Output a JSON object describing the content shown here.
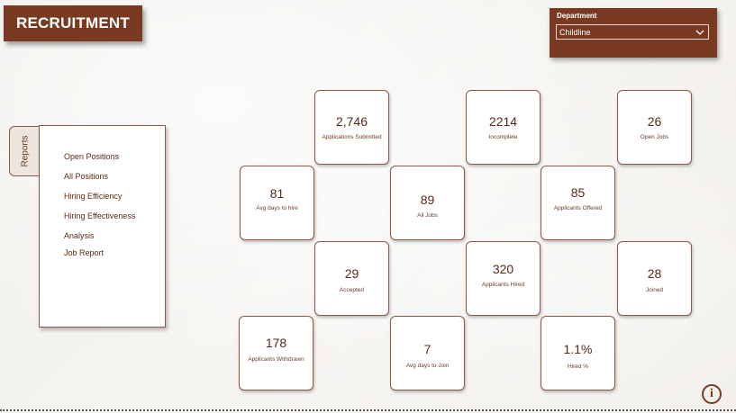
{
  "title": "RECRUITMENT",
  "department": {
    "label": "Department",
    "selected": "Childline"
  },
  "reports": {
    "tab_label": "Reports",
    "items": [
      {
        "label": "Open Positions"
      },
      {
        "label": "All Positions"
      },
      {
        "label": "Hiring Efficiency"
      },
      {
        "label": "Hiring Effectiveness"
      },
      {
        "label": "Analysis"
      },
      {
        "label": "Job Report"
      }
    ]
  },
  "cards": [
    {
      "value": "2,746",
      "label": "Applications Submitted"
    },
    {
      "value": "2214",
      "label": "Incomplete"
    },
    {
      "value": "26",
      "label": "Open Jobs"
    },
    {
      "value": "81",
      "label": "Avg days to hire"
    },
    {
      "value": "89",
      "label": "All Jobs"
    },
    {
      "value": "85",
      "label": "Applicants Offered"
    },
    {
      "value": "29",
      "label": "Accepted"
    },
    {
      "value": "320",
      "label": "Applicants Hired"
    },
    {
      "value": "28",
      "label": "Joined"
    },
    {
      "value": "178",
      "label": "Applicants Withdrawn"
    },
    {
      "value": "7",
      "label": "Avg days to Join"
    },
    {
      "value": "1.1%",
      "label": "Hired %"
    }
  ],
  "colors": {
    "brand": "#7a3a22",
    "text": "#5a2a18",
    "background": "#f4f2ee"
  },
  "icons": {
    "info": "info-icon",
    "dropdown": "chevron-down-icon"
  }
}
